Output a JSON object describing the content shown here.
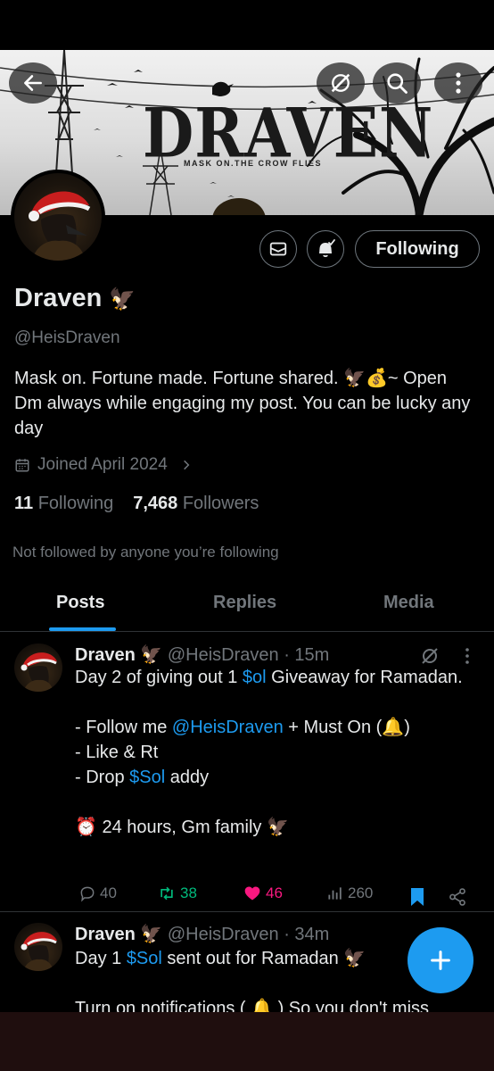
{
  "header": {
    "banner_title": "DRAVEN",
    "banner_subtitle": "MASK ON.THE CROW FLIES"
  },
  "profile": {
    "name": "Draven",
    "name_emoji": "🦅",
    "handle": "@HeisDraven",
    "bio": "Mask on. Fortune made. Fortune shared. 🦅💰~ Open Dm always while engaging my post. You can be lucky any day",
    "joined": "Joined April 2024",
    "following_count": "11",
    "following_label": "Following",
    "followers_count": "7,468",
    "followers_label": "Followers",
    "not_followed_text": "Not followed by anyone you’re following",
    "following_button": "Following"
  },
  "tabs": [
    {
      "label": "Posts",
      "active": true
    },
    {
      "label": "Replies",
      "active": false
    },
    {
      "label": "Media",
      "active": false
    }
  ],
  "tweets": [
    {
      "name": "Draven",
      "emoji": "🦅",
      "handle": "@HeisDraven",
      "time": "· 15m",
      "text_parts": {
        "l1a": "Day 2 of giving out 1 ",
        "l1b": "$ol",
        "l1c": " Giveaway for Ramadan.",
        "l2a": "- Follow me ",
        "l2b": "@HeisDraven",
        "l2c": " + Must On (🔔)",
        "l3": "- Like & Rt",
        "l4a": "- Drop ",
        "l4b": "$Sol",
        "l4c": " addy",
        "l5": "⏰ 24 hours, Gm family 🦅"
      },
      "replies": "40",
      "retweets": "38",
      "likes": "46",
      "views": "260"
    },
    {
      "name": "Draven",
      "emoji": "🦅",
      "handle": "@HeisDraven",
      "time": "· 34m",
      "text_parts": {
        "l1a": "Day 1 ",
        "l1b": "$Sol",
        "l1c": " sent out for Ramadan 🦅",
        "l2": "Turn on notifications ( 🔔 ) So you don't miss"
      }
    }
  ],
  "colors": {
    "accent": "#1d9bf0",
    "like": "#f91880",
    "retweet": "#00ba7c",
    "muted": "#71767b"
  }
}
